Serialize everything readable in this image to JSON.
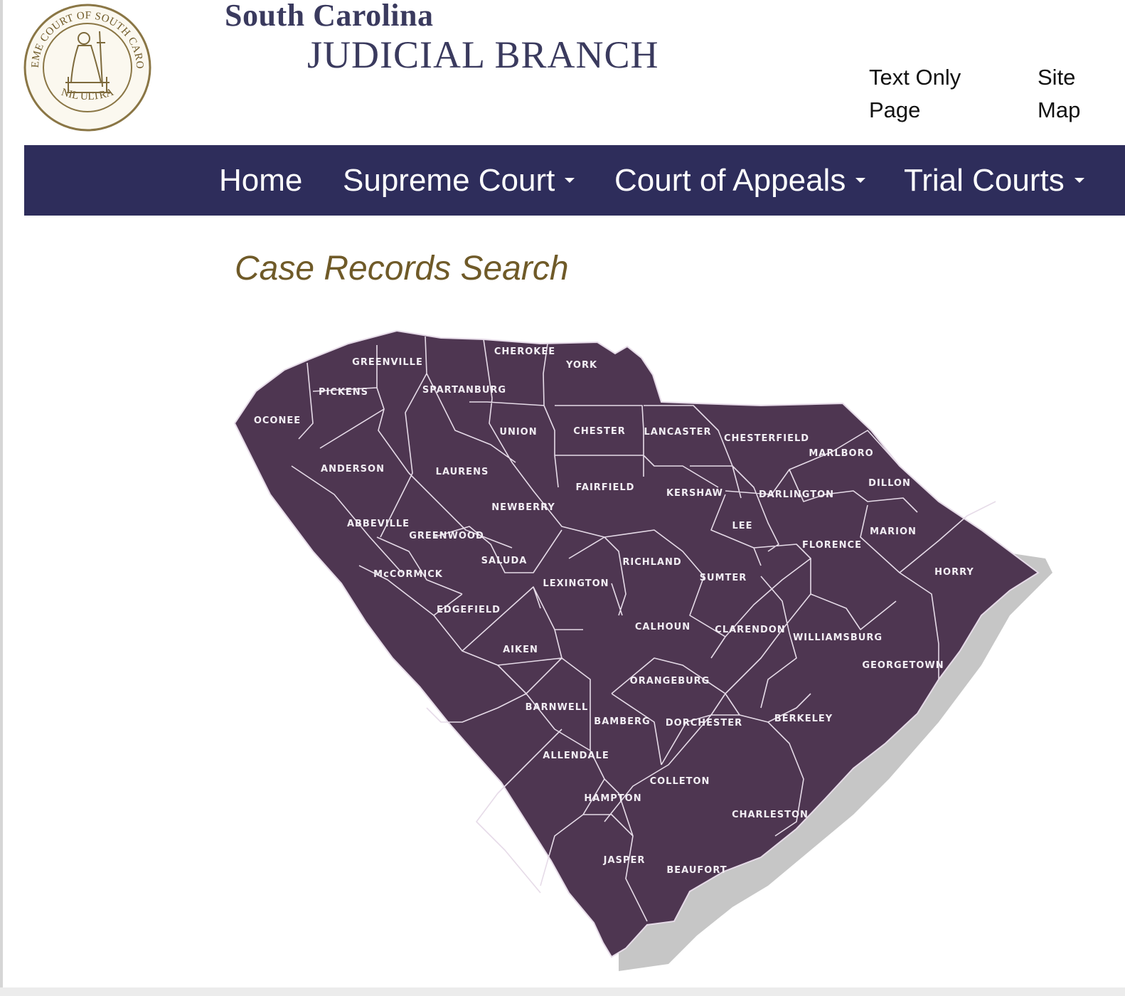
{
  "header": {
    "brand_line1": "South Carolina",
    "brand_line2": "JUDICIAL BRANCH",
    "seal_text_top": "SUPREME COURT OF SOUTH CAROLINA",
    "seal_text_bottom": "NIL ULTRA",
    "seal_icon": "supreme-court-seal-icon",
    "links": [
      {
        "label": "Text Only Page"
      },
      {
        "label": "Site Map"
      }
    ]
  },
  "nav": {
    "items": [
      {
        "label": "Home"
      },
      {
        "label": "Supreme Court"
      },
      {
        "label": "Court of Appeals"
      },
      {
        "label": "Trial Courts"
      }
    ]
  },
  "main": {
    "title": "Case Records Search"
  },
  "map": {
    "fill_color": "#4e3651",
    "border_color": "#e6dbe8",
    "shadow_color": "#c6c6c6",
    "counties": [
      {
        "name": "OCONEE"
      },
      {
        "name": "PICKENS"
      },
      {
        "name": "GREENVILLE"
      },
      {
        "name": "SPARTANBURG"
      },
      {
        "name": "CHEROKEE"
      },
      {
        "name": "YORK"
      },
      {
        "name": "ANDERSON"
      },
      {
        "name": "LAURENS"
      },
      {
        "name": "UNION"
      },
      {
        "name": "CHESTER"
      },
      {
        "name": "LANCASTER"
      },
      {
        "name": "CHESTERFIELD"
      },
      {
        "name": "MARLBORO"
      },
      {
        "name": "DILLON"
      },
      {
        "name": "ABBEVILLE"
      },
      {
        "name": "GREENWOOD"
      },
      {
        "name": "NEWBERRY"
      },
      {
        "name": "FAIRFIELD"
      },
      {
        "name": "KERSHAW"
      },
      {
        "name": "DARLINGTON"
      },
      {
        "name": "LEE"
      },
      {
        "name": "MARION"
      },
      {
        "name": "McCORMICK"
      },
      {
        "name": "SALUDA"
      },
      {
        "name": "RICHLAND"
      },
      {
        "name": "FLORENCE"
      },
      {
        "name": "HORRY"
      },
      {
        "name": "EDGEFIELD"
      },
      {
        "name": "LEXINGTON"
      },
      {
        "name": "SUMTER"
      },
      {
        "name": "CALHOUN"
      },
      {
        "name": "CLARENDON"
      },
      {
        "name": "WILLIAMSBURG"
      },
      {
        "name": "AIKEN"
      },
      {
        "name": "ORANGEBURG"
      },
      {
        "name": "GEORGETOWN"
      },
      {
        "name": "BARNWELL"
      },
      {
        "name": "BAMBERG"
      },
      {
        "name": "DORCHESTER"
      },
      {
        "name": "BERKELEY"
      },
      {
        "name": "ALLENDALE"
      },
      {
        "name": "COLLETON"
      },
      {
        "name": "HAMPTON"
      },
      {
        "name": "CHARLESTON"
      },
      {
        "name": "JASPER"
      },
      {
        "name": "BEAUFORT"
      }
    ]
  }
}
